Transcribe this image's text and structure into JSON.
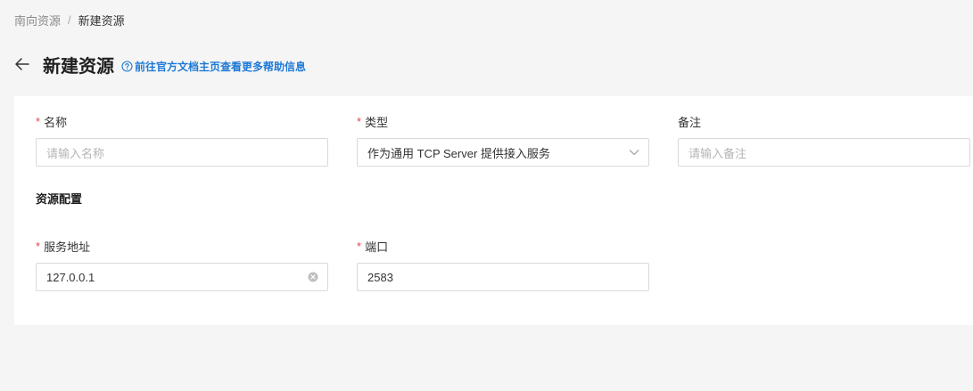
{
  "breadcrumb": {
    "parent": "南向资源",
    "separator": "/",
    "current": "新建资源"
  },
  "header": {
    "title": "新建资源",
    "help_text": "前往官方文档主页查看更多帮助信息"
  },
  "form": {
    "name": {
      "required_mark": "*",
      "label": "名称",
      "placeholder": "请输入名称",
      "value": ""
    },
    "type": {
      "required_mark": "*",
      "label": "类型",
      "value": "作为通用 TCP Server 提供接入服务"
    },
    "remark": {
      "label": "备注",
      "placeholder": "请输入备注",
      "value": ""
    },
    "config_section_title": "资源配置",
    "address": {
      "required_mark": "*",
      "label": "服务地址",
      "value": "127.0.0.1"
    },
    "port": {
      "required_mark": "*",
      "label": "端口",
      "value": "2583"
    }
  },
  "colors": {
    "required": "#e5484d",
    "link": "#1e7ad6",
    "background": "#f5f5f5"
  },
  "icons": [
    "back-arrow-icon",
    "help-circle-icon",
    "chevron-down-icon",
    "clear-icon"
  ]
}
